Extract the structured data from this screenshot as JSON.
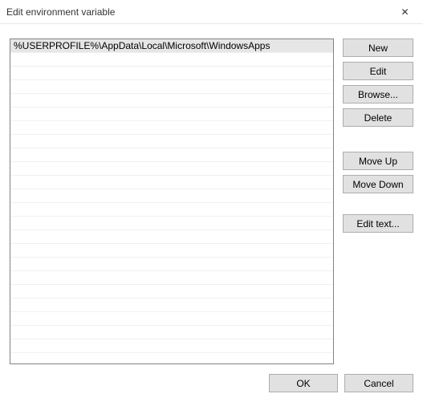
{
  "dialog": {
    "title": "Edit environment variable"
  },
  "list": {
    "rows": [
      "%USERPROFILE%\\AppData\\Local\\Microsoft\\WindowsApps",
      "",
      "",
      "",
      "",
      "",
      "",
      "",
      "",
      "",
      "",
      "",
      "",
      "",
      "",
      "",
      "",
      "",
      "",
      "",
      "",
      "",
      ""
    ],
    "selectedIndex": 0
  },
  "buttons": {
    "new": "New",
    "edit": "Edit",
    "browse": "Browse...",
    "delete": "Delete",
    "moveUp": "Move Up",
    "moveDown": "Move Down",
    "editText": "Edit text...",
    "ok": "OK",
    "cancel": "Cancel"
  }
}
